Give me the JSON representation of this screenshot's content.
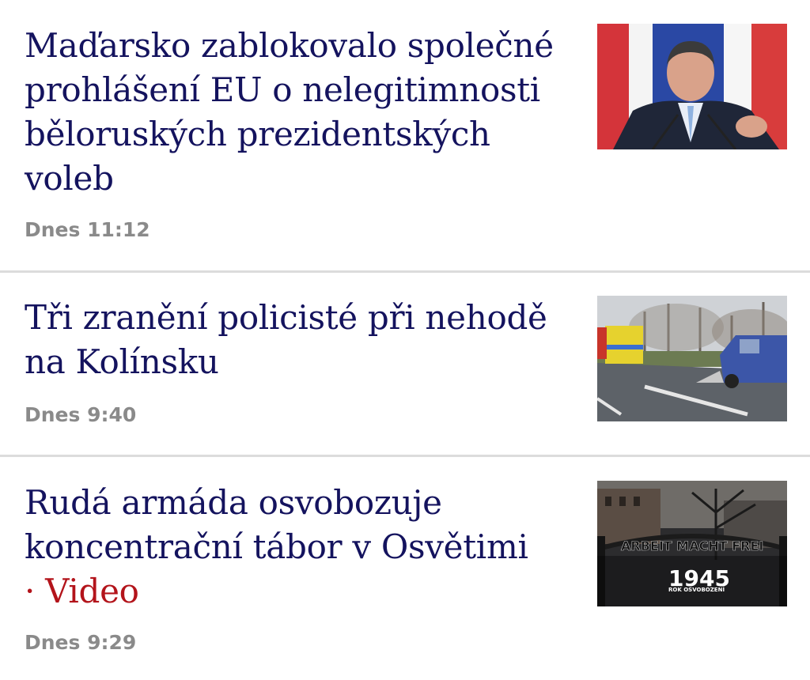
{
  "articles": [
    {
      "title": "Maďarsko zablokovalo společné prohlášení EU o nelegitimnosti běloruských prezidentských voleb",
      "time": "Dnes 11:12",
      "thumbnail": "photo of a politician speaking at microphones in front of flags"
    },
    {
      "title": "Tři zranění policisté při nehodě na Kolínsku",
      "time": "Dnes 9:40",
      "thumbnail": "photo of a crashed van and ambulance on a road"
    },
    {
      "title": "Rudá armáda osvobozuje koncentrační tábor v Osvětimi",
      "video_label": "· Video",
      "time": "Dnes 9:29",
      "thumbnail": "photo of camp entrance gate with sign",
      "thumb_sign": "ARBEIT MACHT FREI",
      "thumb_caption": "ROK OSVOBOZENÍ",
      "thumb_year": "1945"
    }
  ],
  "colors": {
    "headline": "#14135e",
    "video": "#b3141b",
    "timestamp": "#8a8a8a",
    "divider": "#dcdcdc"
  }
}
